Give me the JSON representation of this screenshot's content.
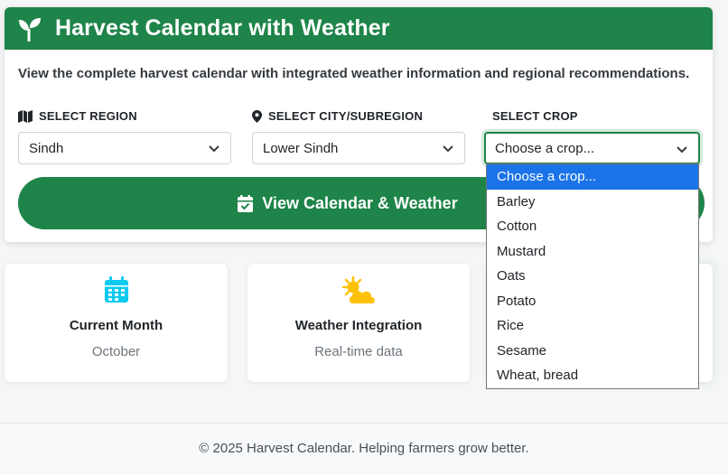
{
  "header": {
    "title": "Harvest Calendar with Weather",
    "icon": "seedling-icon"
  },
  "lead": "View the complete harvest calendar with integrated weather information and regional recommendations.",
  "region": {
    "label": "SELECT REGION",
    "value": "Sindh",
    "icon": "map-icon"
  },
  "city": {
    "label": "SELECT CITY/SUBREGION",
    "value": "Lower Sindh",
    "icon": "map-marker-icon"
  },
  "crop": {
    "label": "SELECT CROP",
    "value": "Choose a crop...",
    "options": [
      "Choose a crop...",
      "Barley",
      "Cotton",
      "Mustard",
      "Oats",
      "Potato",
      "Rice",
      "Sesame",
      "Wheat, bread"
    ]
  },
  "view_button": {
    "label": "View Calendar & Weather",
    "icon": "calendar-check-icon"
  },
  "cards": [
    {
      "title": "Current Month",
      "subtitle": "October",
      "icon": "calendar-icon"
    },
    {
      "title": "Weather Integration",
      "subtitle": "Real-time data",
      "icon": "sun-cloud-icon"
    }
  ],
  "footer": "© 2025 Harvest Calendar. Helping farmers grow better.",
  "colors": {
    "primary": "#1e8449",
    "calendar_icon": "#0dcaf0",
    "weather_icon": "#ffc107",
    "selected_option": "#1a73e8"
  }
}
